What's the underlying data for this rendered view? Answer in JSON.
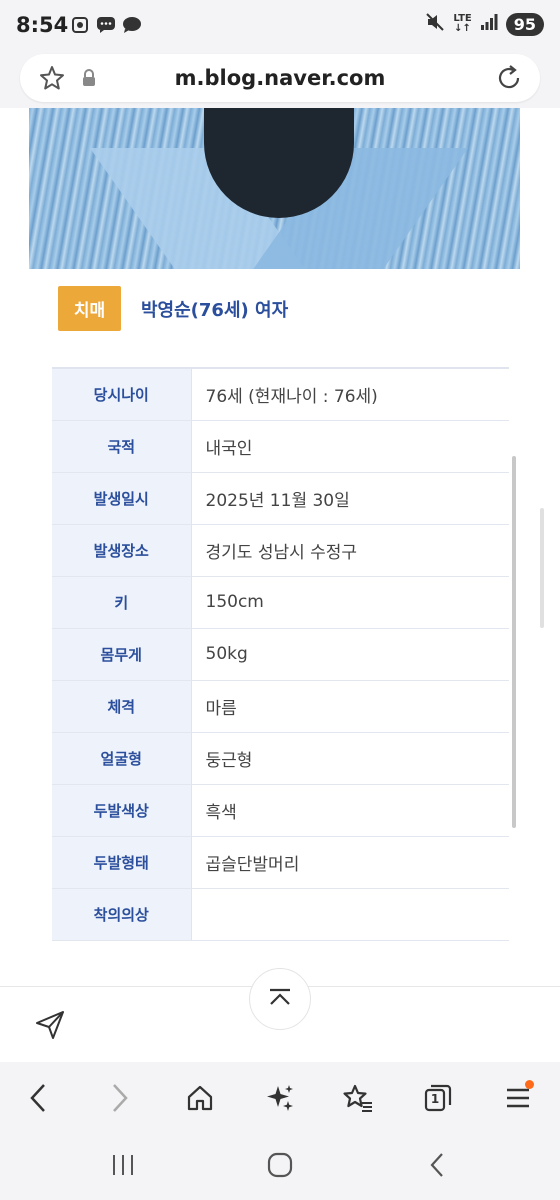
{
  "status_bar": {
    "time": "8:54",
    "network": "LTE",
    "battery": "95"
  },
  "url_bar": {
    "url": "m.blog.naver.com"
  },
  "profile": {
    "badge": "치매",
    "name": "박영순(76세) 여자"
  },
  "info_rows": [
    {
      "label": "당시나이",
      "value": "76세 (현재나이 : 76세)"
    },
    {
      "label": "국적",
      "value": "내국인"
    },
    {
      "label": "발생일시",
      "value": "2025년 11월 30일"
    },
    {
      "label": "발생장소",
      "value": "경기도 성남시 수정구"
    },
    {
      "label": "키",
      "value": "150cm"
    },
    {
      "label": "몸무게",
      "value": "50kg"
    },
    {
      "label": "체격",
      "value": "마름"
    },
    {
      "label": "얼굴형",
      "value": "둥근형"
    },
    {
      "label": "두발색상",
      "value": "흑색"
    },
    {
      "label": "두발형태",
      "value": "곱슬단발머리"
    },
    {
      "label": "착의의상",
      "value": ""
    }
  ],
  "toolbar": {
    "tab_count": "1"
  },
  "icons": {
    "share": "send-icon",
    "scroll_top": "chevron-up-icon",
    "back": "back-arrow-icon",
    "forward": "forward-arrow-icon",
    "home": "home-icon",
    "ai": "sparkle-icon",
    "bookmarks": "bookmark-star-icon",
    "tabs": "tabs-icon",
    "menu": "menu-icon"
  },
  "colors": {
    "badge": "#eda83a",
    "label_text": "#2b4f9c",
    "label_bg": "#eef3fb",
    "menu_dot": "#ff6a1a"
  }
}
